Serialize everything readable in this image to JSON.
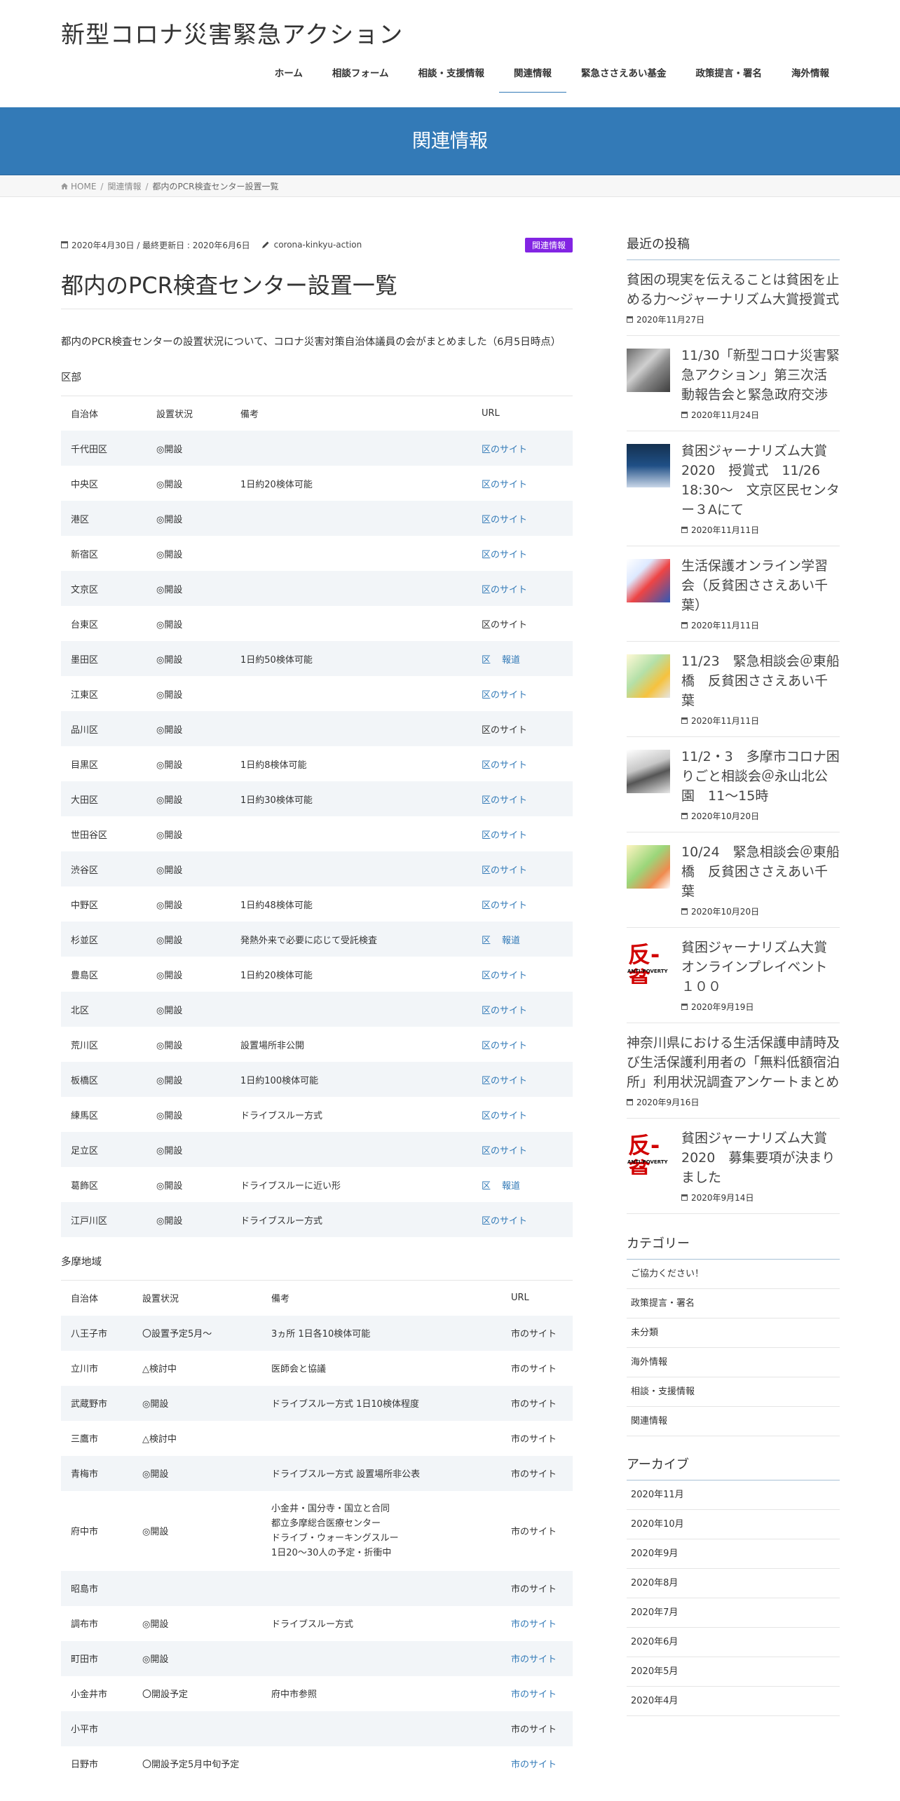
{
  "site": {
    "title": "新型コロナ災害緊急アクション"
  },
  "nav": [
    {
      "label": "ホーム"
    },
    {
      "label": "相談フォーム"
    },
    {
      "label": "相談・支援情報"
    },
    {
      "label": "関連情報",
      "active": true
    },
    {
      "label": "緊急ささえあい基金"
    },
    {
      "label": "政策提言・署名"
    },
    {
      "label": "海外情報"
    }
  ],
  "page_header": {
    "title": "関連情報"
  },
  "breadcrumb": {
    "home": "HOME",
    "parent": "関連情報",
    "current": "都内のPCR検査センター設置一覧"
  },
  "post": {
    "meta_dates": "2020年4月30日 / 最終更新日 : 2020年6月6日",
    "author": "corona-kinkyu-action",
    "category": "関連情報",
    "title": "都内のPCR検査センター設置一覧",
    "lead": "都内のPCR検査センターの設置状況について、コロナ災害対策自治体議員の会がまとめました（6月5日時点）"
  },
  "ku_section": {
    "label": "区部",
    "headers": [
      "自治体",
      "設置状況",
      "備考",
      "URL"
    ],
    "rows": [
      {
        "name": "千代田区",
        "status": "◎開設",
        "note": "",
        "url": "区のサイト",
        "linked": true
      },
      {
        "name": "中央区",
        "status": "◎開設",
        "note": "1日約20検体可能",
        "url": "区のサイト",
        "linked": true
      },
      {
        "name": "港区",
        "status": "◎開設",
        "note": "",
        "url": "区のサイト",
        "linked": true
      },
      {
        "name": "新宿区",
        "status": "◎開設",
        "note": "",
        "url": "区のサイト",
        "linked": true
      },
      {
        "name": "文京区",
        "status": "◎開設",
        "note": "",
        "url": "区のサイト",
        "linked": true
      },
      {
        "name": "台東区",
        "status": "◎開設",
        "note": "",
        "url": "区のサイト",
        "linked": false
      },
      {
        "name": "墨田区",
        "status": "◎開設",
        "note": "1日約50検体可能",
        "url": "区",
        "url2": "報道",
        "linked": true
      },
      {
        "name": "江東区",
        "status": "◎開設",
        "note": "",
        "url": "区のサイト",
        "linked": true
      },
      {
        "name": "品川区",
        "status": "◎開設",
        "note": "",
        "url": "区のサイト",
        "linked": false
      },
      {
        "name": "目黒区",
        "status": "◎開設",
        "note": "1日約8検体可能",
        "url": "区のサイト",
        "linked": true
      },
      {
        "name": "大田区",
        "status": "◎開設",
        "note": "1日約30検体可能",
        "url": "区のサイト",
        "linked": true
      },
      {
        "name": "世田谷区",
        "status": "◎開設",
        "note": "",
        "url": "区のサイト",
        "linked": true
      },
      {
        "name": "渋谷区",
        "status": "◎開設",
        "note": "",
        "url": "区のサイト",
        "linked": true
      },
      {
        "name": "中野区",
        "status": "◎開設",
        "note": "1日約48検体可能",
        "url": "区のサイト",
        "linked": true
      },
      {
        "name": "杉並区",
        "status": "◎開設",
        "note": "発熱外来で必要に応じて受託検査",
        "url": "区",
        "url2": "報道",
        "linked": true
      },
      {
        "name": "豊島区",
        "status": "◎開設",
        "note": "1日約20検体可能",
        "url": "区のサイト",
        "linked": true
      },
      {
        "name": "北区",
        "status": "◎開設",
        "note": "",
        "url": "区のサイト",
        "linked": true
      },
      {
        "name": "荒川区",
        "status": "◎開設",
        "note": "設置場所非公開",
        "url": "区のサイト",
        "linked": true
      },
      {
        "name": "板橋区",
        "status": "◎開設",
        "note": "1日約100検体可能",
        "url": "区のサイト",
        "linked": true
      },
      {
        "name": "練馬区",
        "status": "◎開設",
        "note": "ドライブスルー方式",
        "url": "区のサイト",
        "linked": true
      },
      {
        "name": "足立区",
        "status": "◎開設",
        "note": "",
        "url": "区のサイト",
        "linked": true
      },
      {
        "name": "葛飾区",
        "status": "◎開設",
        "note": "ドライブスルーに近い形",
        "url": "区",
        "url2": "報道",
        "linked": true
      },
      {
        "name": "江戸川区",
        "status": "◎開設",
        "note": "ドライブスルー方式",
        "url": "区のサイト",
        "linked": true
      }
    ]
  },
  "tama_section": {
    "label": "多摩地域",
    "headers": [
      "自治体",
      "設置状況",
      "備考",
      "URL"
    ],
    "rows": [
      {
        "name": "八王子市",
        "status": "〇設置予定5月～",
        "note": "3ヵ所 1日各10検体可能",
        "url": "市のサイト",
        "linked": false
      },
      {
        "name": "立川市",
        "status": "△検討中",
        "note": "医師会と協議",
        "url": "市のサイト",
        "linked": false
      },
      {
        "name": "武蔵野市",
        "status": "◎開設",
        "note": "ドライブスルー方式 1日10検体程度",
        "url": "市のサイト",
        "linked": false
      },
      {
        "name": "三鷹市",
        "status": "△検討中",
        "note": "",
        "url": "市のサイト",
        "linked": false
      },
      {
        "name": "青梅市",
        "status": "◎開設",
        "note": "ドライブスルー方式 設置場所非公表",
        "url": "市のサイト",
        "linked": false
      },
      {
        "name": "府中市",
        "status": "◎開設",
        "note_lines": [
          "小金井・国分寺・国立と合同",
          "都立多摩総合医療センター",
          "ドライブ・ウォーキングスルー",
          "1日20～30人の予定・折衝中"
        ],
        "url": "市のサイト",
        "linked": false,
        "tall": true
      },
      {
        "name": "昭島市",
        "status": "",
        "note": "",
        "url": "市のサイト",
        "linked": false
      },
      {
        "name": "調布市",
        "status": "◎開設",
        "note": "ドライブスルー方式",
        "url": "市のサイト",
        "linked": true
      },
      {
        "name": "町田市",
        "status": "◎開設",
        "note": "",
        "url": "市のサイト",
        "linked": true
      },
      {
        "name": "小金井市",
        "status": "〇開設予定",
        "note": "府中市参照",
        "url": "市のサイト",
        "linked": true
      },
      {
        "name": "小平市",
        "status": "",
        "note": "",
        "url": "市のサイト",
        "linked": false
      },
      {
        "name": "日野市",
        "status": "〇開設予定5月中旬予定",
        "note": "",
        "url": "市のサイト",
        "linked": true
      }
    ]
  },
  "sidebar": {
    "recent_title": "最近の投稿",
    "posts": [
      {
        "title": "貧困の現実を伝えることは貧困を止める力～ジャーナリズム大賞授賞式",
        "date": "2020年11月27日",
        "thumb": "none"
      },
      {
        "title": "11/30「新型コロナ災害緊急アクション」第三次活動報告会と緊急政府交渉",
        "date": "2020年11月24日",
        "thumb": "t1"
      },
      {
        "title": "貧困ジャーナリズム大賞2020　授賞式　11/26 18:30～　文京区民センター３Aにて",
        "date": "2020年11月11日",
        "thumb": "t2"
      },
      {
        "title": "生活保護オンライン学習会（反貧困ささえあい千葉）",
        "date": "2020年11月11日",
        "thumb": "t3"
      },
      {
        "title": "11/23　緊急相談会＠東船橋　反貧困ささえあい千葉",
        "date": "2020年11月11日",
        "thumb": "t4"
      },
      {
        "title": "11/2・3　多摩市コロナ困りごと相談会＠永山北公園　11～15時",
        "date": "2020年10月20日",
        "thumb": "t5"
      },
      {
        "title": "10/24　緊急相談会＠東船橋　反貧困ささえあい千葉",
        "date": "2020年10月20日",
        "thumb": "t6"
      },
      {
        "title": "貧困ジャーナリズム大賞オンラインプレイベント１００",
        "date": "2020年9月19日",
        "thumb": "t7"
      },
      {
        "title": "神奈川県における生活保護申請時及び生活保護利用者の「無料低額宿泊所」利用状況調査アンケートまとめ",
        "date": "2020年9月16日",
        "thumb": "none"
      },
      {
        "title": "貧困ジャーナリズム大賞2020　募集要項が決まりました",
        "date": "2020年9月14日",
        "thumb": "t8"
      }
    ],
    "thumb_logo": {
      "big": "反-貧",
      "small": "ANTI-POVERTY"
    },
    "categories_title": "カテゴリー",
    "categories": [
      "ご協力ください！",
      "政策提言・署名",
      "未分類",
      "海外情報",
      "相談・支援情報",
      "関連情報"
    ],
    "archive_title": "アーカイブ",
    "archives": [
      "2020年11月",
      "2020年10月",
      "2020年9月",
      "2020年8月",
      "2020年7月",
      "2020年6月",
      "2020年5月",
      "2020年4月"
    ]
  },
  "colors": {
    "accent": "#337ab7",
    "badge": "#8224e3",
    "row_alt": "#f2f5f8"
  },
  "icons": {
    "home": "home-icon",
    "calendar": "calendar-icon",
    "pencil": "pencil-icon"
  }
}
